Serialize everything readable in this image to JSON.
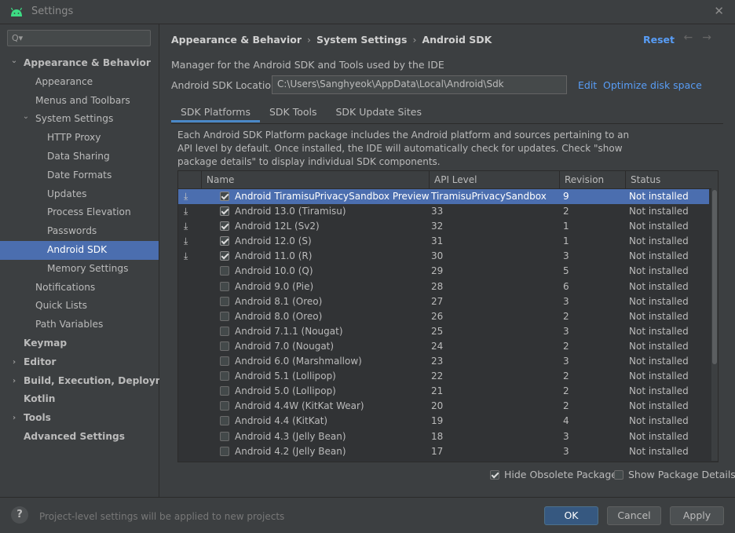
{
  "window": {
    "title": "Settings"
  },
  "sidebar": {
    "items": [
      {
        "label": "Appearance & Behavior",
        "level": 0,
        "bold": true,
        "arrow": "down"
      },
      {
        "label": "Appearance",
        "level": 1
      },
      {
        "label": "Menus and Toolbars",
        "level": 1
      },
      {
        "label": "System Settings",
        "level": 1,
        "arrow": "down"
      },
      {
        "label": "HTTP Proxy",
        "level": 2
      },
      {
        "label": "Data Sharing",
        "level": 2
      },
      {
        "label": "Date Formats",
        "level": 2
      },
      {
        "label": "Updates",
        "level": 2
      },
      {
        "label": "Process Elevation",
        "level": 2
      },
      {
        "label": "Passwords",
        "level": 2
      },
      {
        "label": "Android SDK",
        "level": 2,
        "selected": true
      },
      {
        "label": "Memory Settings",
        "level": 2
      },
      {
        "label": "Notifications",
        "level": 1
      },
      {
        "label": "Quick Lists",
        "level": 1
      },
      {
        "label": "Path Variables",
        "level": 1
      },
      {
        "label": "Keymap",
        "level": 0,
        "bold": true
      },
      {
        "label": "Editor",
        "level": 0,
        "bold": true,
        "arrow": "right"
      },
      {
        "label": "Build, Execution, Deployment",
        "level": 0,
        "bold": true,
        "arrow": "right"
      },
      {
        "label": "Kotlin",
        "level": 0,
        "bold": true
      },
      {
        "label": "Tools",
        "level": 0,
        "bold": true,
        "arrow": "right"
      },
      {
        "label": "Advanced Settings",
        "level": 0,
        "bold": true
      }
    ]
  },
  "header": {
    "crumbs": [
      "Appearance & Behavior",
      "System Settings",
      "Android SDK"
    ],
    "reset_label": "Reset"
  },
  "main": {
    "description": "Manager for the Android SDK and Tools used by the IDE",
    "location_label": "Android SDK Location:",
    "location_value": "C:\\Users\\Sanghyeok\\AppData\\Local\\Android\\Sdk",
    "edit_label": "Edit",
    "optimize_label": "Optimize disk space",
    "tabs": [
      "SDK Platforms",
      "SDK Tools",
      "SDK Update Sites"
    ],
    "package_desc": "Each Android SDK Platform package includes the Android platform and sources pertaining to an API level by default. Once installed, the IDE will automatically check for updates. Check \"show package details\" to display individual SDK components."
  },
  "table": {
    "columns": [
      "Name",
      "API Level",
      "Revision",
      "Status"
    ],
    "rows": [
      {
        "name": "Android TiramisuPrivacySandbox Preview",
        "api": "TiramisuPrivacySandbox",
        "rev": "9",
        "status": "Not installed",
        "checked": true,
        "download": true,
        "selected": true
      },
      {
        "name": "Android 13.0 (Tiramisu)",
        "api": "33",
        "rev": "2",
        "status": "Not installed",
        "checked": true,
        "download": true
      },
      {
        "name": "Android 12L (Sv2)",
        "api": "32",
        "rev": "1",
        "status": "Not installed",
        "checked": true,
        "download": true
      },
      {
        "name": "Android 12.0 (S)",
        "api": "31",
        "rev": "1",
        "status": "Not installed",
        "checked": true,
        "download": true
      },
      {
        "name": "Android 11.0 (R)",
        "api": "30",
        "rev": "3",
        "status": "Not installed",
        "checked": true,
        "download": true
      },
      {
        "name": "Android 10.0 (Q)",
        "api": "29",
        "rev": "5",
        "status": "Not installed"
      },
      {
        "name": "Android 9.0 (Pie)",
        "api": "28",
        "rev": "6",
        "status": "Not installed"
      },
      {
        "name": "Android 8.1 (Oreo)",
        "api": "27",
        "rev": "3",
        "status": "Not installed"
      },
      {
        "name": "Android 8.0 (Oreo)",
        "api": "26",
        "rev": "2",
        "status": "Not installed"
      },
      {
        "name": "Android 7.1.1 (Nougat)",
        "api": "25",
        "rev": "3",
        "status": "Not installed"
      },
      {
        "name": "Android 7.0 (Nougat)",
        "api": "24",
        "rev": "2",
        "status": "Not installed"
      },
      {
        "name": "Android 6.0 (Marshmallow)",
        "api": "23",
        "rev": "3",
        "status": "Not installed"
      },
      {
        "name": "Android 5.1 (Lollipop)",
        "api": "22",
        "rev": "2",
        "status": "Not installed"
      },
      {
        "name": "Android 5.0 (Lollipop)",
        "api": "21",
        "rev": "2",
        "status": "Not installed"
      },
      {
        "name": "Android 4.4W (KitKat Wear)",
        "api": "20",
        "rev": "2",
        "status": "Not installed"
      },
      {
        "name": "Android 4.4 (KitKat)",
        "api": "19",
        "rev": "4",
        "status": "Not installed"
      },
      {
        "name": "Android 4.3 (Jelly Bean)",
        "api": "18",
        "rev": "3",
        "status": "Not installed"
      },
      {
        "name": "Android 4.2 (Jelly Bean)",
        "api": "17",
        "rev": "3",
        "status": "Not installed"
      }
    ]
  },
  "options": {
    "hide_obsolete": "Hide Obsolete Packages",
    "show_details": "Show Package Details"
  },
  "footer": {
    "note": "Project-level settings will be applied to new projects",
    "ok": "OK",
    "cancel": "Cancel",
    "apply": "Apply"
  },
  "colors": {
    "selection": "#4b6eaf",
    "link": "#589df6",
    "android_green": "#3ddc84"
  },
  "icons": {
    "window": "android-icon",
    "close": "close-icon",
    "download": "download-icon",
    "help": "help-icon"
  }
}
